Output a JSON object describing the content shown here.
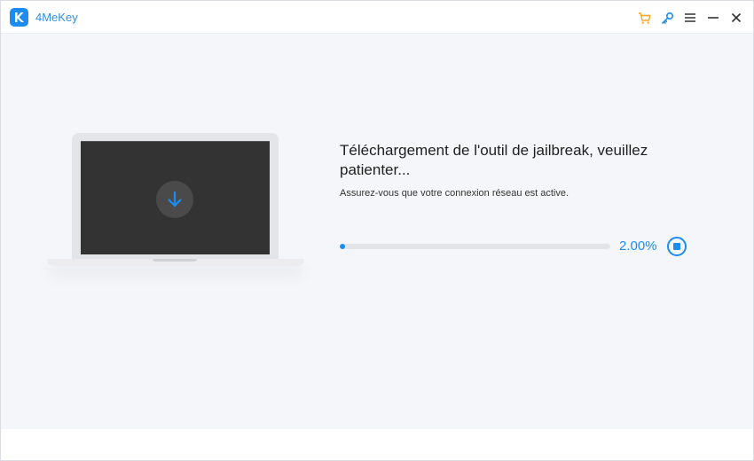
{
  "app": {
    "title": "4MeKey",
    "accent_color": "#1d8cf1"
  },
  "titlebar": {
    "icons": [
      "cart-icon",
      "key-icon",
      "menu-icon",
      "minimize-icon",
      "close-icon"
    ],
    "cart_color": "#f5a623"
  },
  "main": {
    "heading": "Téléchargement de l'outil de jailbreak, veuillez patienter...",
    "subtext": "Assurez-vous que votre connexion réseau est active.",
    "progress": {
      "percent_text": "2.00%",
      "value": 0.02
    }
  }
}
